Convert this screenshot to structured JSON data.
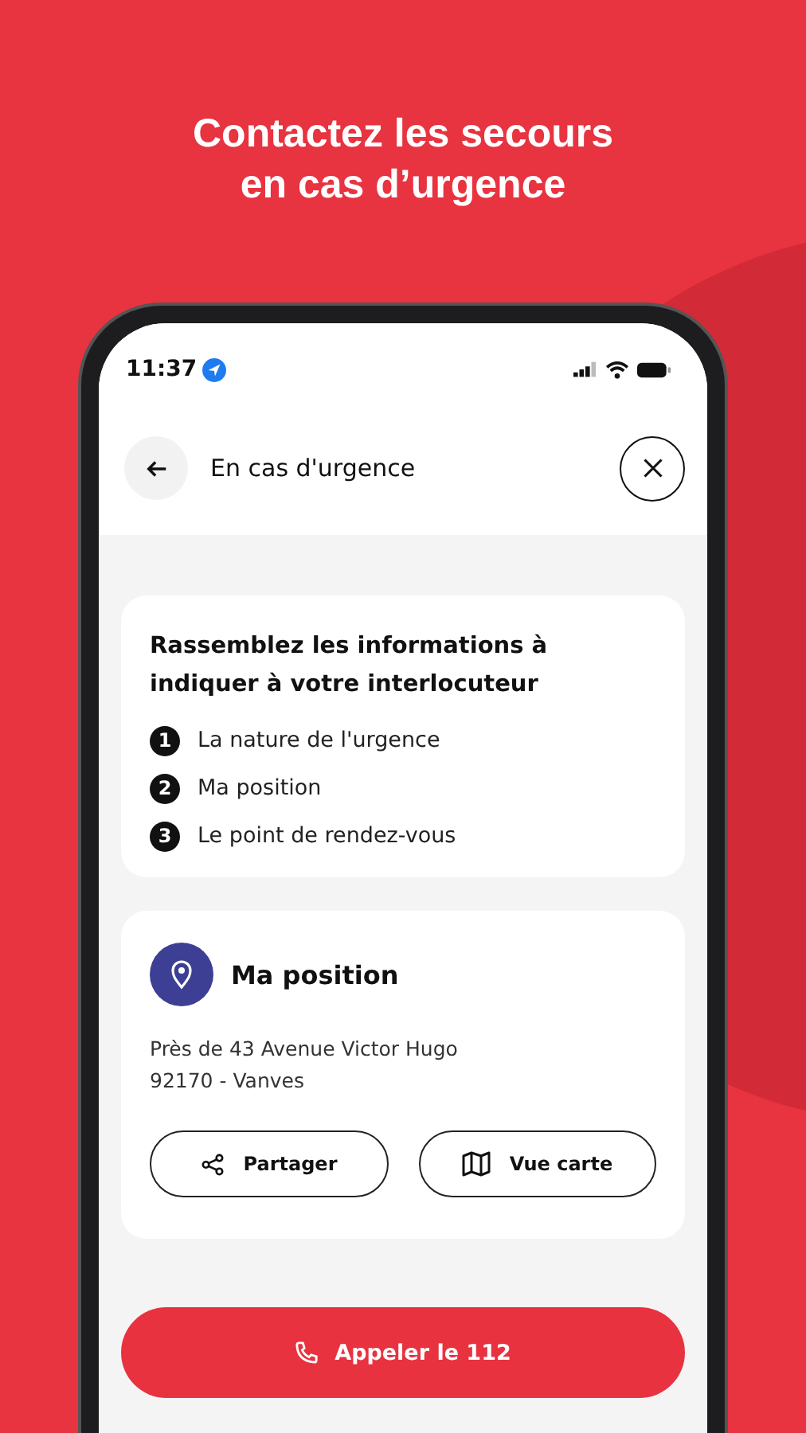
{
  "headline": "Contactez les secours en cas d’urgence",
  "status_bar": {
    "time": "11:37"
  },
  "header": {
    "title": "En cas d'urgence"
  },
  "info_card": {
    "title": "Rassemblez les informations à indiquer à votre interlocuteur",
    "steps": [
      {
        "number": "1",
        "label": "La nature de l'urgence"
      },
      {
        "number": "2",
        "label": "Ma position"
      },
      {
        "number": "3",
        "label": "Le point de rendez-vous"
      }
    ]
  },
  "position_card": {
    "title": "Ma position",
    "address_lines": [
      "Près de 43 Avenue Victor Hugo",
      "92170 - Vanves"
    ],
    "buttons": [
      {
        "kind": "share",
        "label": "Partager"
      },
      {
        "kind": "map",
        "label": "Vue carte"
      }
    ]
  },
  "call_button": {
    "label": "Appeler le 112"
  }
}
